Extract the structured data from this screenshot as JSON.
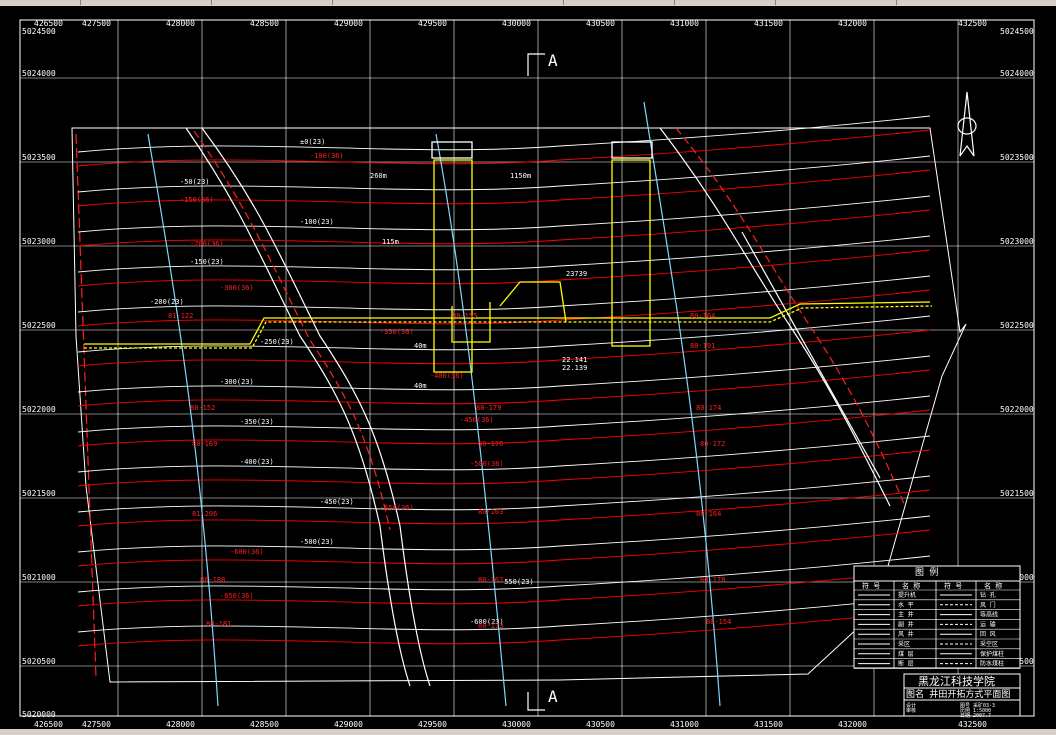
{
  "colors": {
    "frame": "#ffffff",
    "ref_grid": "#ffffff",
    "contour_a": "#ffffff",
    "contour_b": "#ff0000",
    "roadway": "#ffff00",
    "borehole_line": "#80d8ff",
    "label_red": "#ff2020",
    "background": "#000000"
  },
  "coord_labels": {
    "top_x": [
      "426500",
      "427500",
      "428000",
      "428500",
      "429000",
      "429500",
      "430000",
      "430500",
      "431000",
      "431500",
      "432000",
      "432500"
    ],
    "bottom_x": [
      "426500",
      "427500",
      "428000",
      "428500",
      "429000",
      "429500",
      "430000",
      "430500",
      "431000",
      "431500",
      "432000",
      "432500"
    ],
    "left_y": [
      "5024500",
      "5024000",
      "5023500",
      "5023000",
      "5022500",
      "5022000",
      "5021500",
      "5021000",
      "5020500",
      "5020000"
    ],
    "right_y": [
      "5024500",
      "5024000",
      "5023500",
      "5023000",
      "5022500",
      "5022000",
      "5021500",
      "5021000",
      "5020500"
    ]
  },
  "section_marks": {
    "top": "A",
    "bottom": "A"
  },
  "contours_white": [
    "±0(23)",
    "-50(23)",
    "-100(23)",
    "-150(23)",
    "-200(23)",
    "-250(23)",
    "-300(23)",
    "-350(23)",
    "-400(23)",
    "-450(23)",
    "-500(23)",
    "-550(23)",
    "-600(23)"
  ],
  "contours_red": [
    "-100(36)",
    "-150(36)",
    "-200(36)",
    "-300(36)",
    "-350(36)",
    "-400(36)",
    "-450(36)",
    "-500(36)",
    "-550(36)",
    "-600(36)",
    "-650(36)"
  ],
  "boreholes": [
    "81-122",
    "80-152",
    "80-169",
    "81-206",
    "80-188",
    "80-181",
    "80-179",
    "80-176",
    "80-163",
    "80-162",
    "80-173",
    "80-164",
    "80-191",
    "80-174",
    "80-172",
    "80-164",
    "80-178",
    "80-154",
    "80-155"
  ],
  "annotations": [
    "260m",
    "1150m",
    "115m",
    "40m",
    "40m",
    "23739",
    "22.141",
    "22.139"
  ],
  "legend": {
    "title": "图 例",
    "headers": [
      "符 号",
      "名 称",
      "符 号",
      "名 称"
    ],
    "left_names": [
      "提升机",
      "水 平",
      "主 井",
      "副 井",
      "风 井",
      "采区",
      "煤 层",
      "断 层"
    ],
    "right_names": [
      "钻 孔",
      "风 门",
      "等高线",
      "运 输",
      "回 风",
      "采空区",
      "保护煤柱",
      "防水煤柱"
    ]
  },
  "title_block": {
    "school": "黑龙江科技学院",
    "drawing_name": "图名  井田开拓方式平面图",
    "fields": [
      {
        "label": "设计",
        "value": ""
      },
      {
        "label": "审核",
        "value": ""
      },
      {
        "label": "图号",
        "value": "采矿03-3"
      },
      {
        "label": "比例",
        "value": "1:5000"
      },
      {
        "label": "日期",
        "value": "2007.7"
      }
    ]
  }
}
